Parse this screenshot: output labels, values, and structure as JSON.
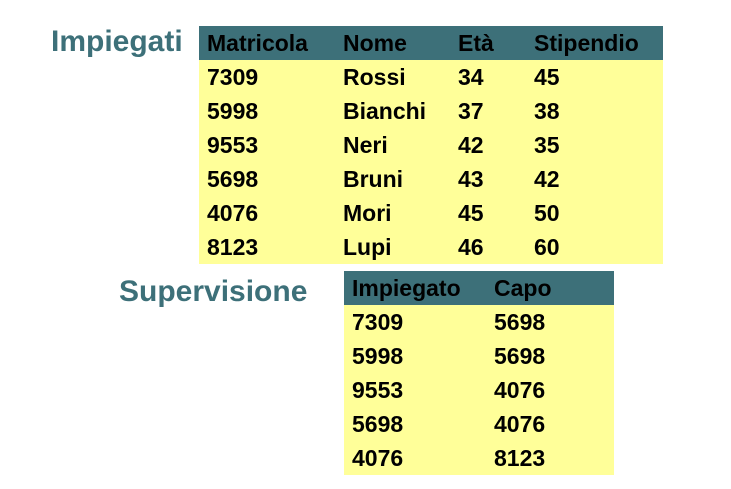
{
  "impiegati": {
    "title": "Impiegati",
    "headers": [
      "Matricola",
      "Nome",
      "Età",
      "Stipendio"
    ],
    "rows": [
      [
        "7309",
        "Rossi",
        "34",
        "45"
      ],
      [
        "5998",
        "Bianchi",
        "37",
        "38"
      ],
      [
        "9553",
        "Neri",
        "42",
        "35"
      ],
      [
        "5698",
        "Bruni",
        "43",
        "42"
      ],
      [
        "4076",
        "Mori",
        "45",
        "50"
      ],
      [
        "8123",
        "Lupi",
        "46",
        "60"
      ]
    ]
  },
  "supervisione": {
    "title": "Supervisione",
    "headers": [
      "Impiegato",
      "Capo"
    ],
    "rows": [
      [
        "7309",
        "5698"
      ],
      [
        "5998",
        "5698"
      ],
      [
        "9553",
        "4076"
      ],
      [
        "5698",
        "4076"
      ],
      [
        "4076",
        "8123"
      ]
    ]
  },
  "colors": {
    "title": "#3d7079",
    "header_bg": "#3d7079",
    "row_bg": "#ffff99"
  }
}
